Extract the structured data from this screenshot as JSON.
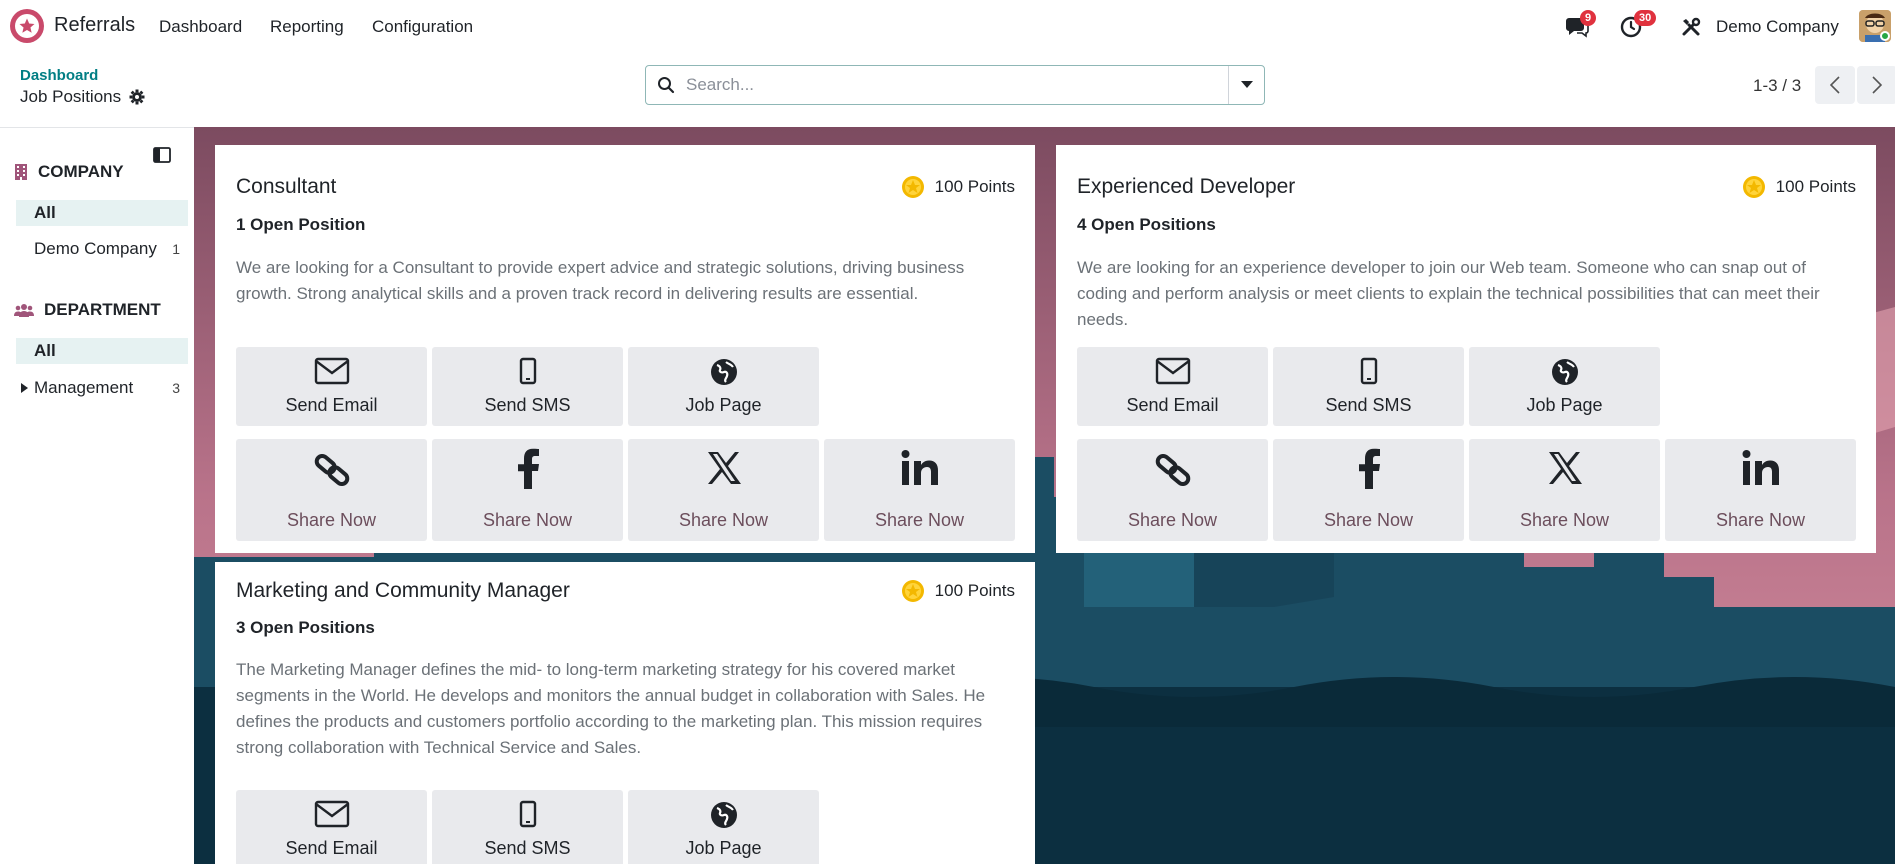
{
  "app": {
    "name": "Referrals"
  },
  "nav": {
    "items": [
      "Dashboard",
      "Reporting",
      "Configuration"
    ]
  },
  "systray": {
    "messages_count": "9",
    "activities_count": "30",
    "company": "Demo Company"
  },
  "control_panel": {
    "breadcrumb": "Dashboard",
    "title": "Job Positions",
    "search_placeholder": "Search...",
    "pager": "1-3 / 3"
  },
  "sidebar": {
    "company_heading": "COMPANY",
    "company_items": [
      {
        "label": "All",
        "count": ""
      },
      {
        "label": "Demo Company",
        "count": "1"
      }
    ],
    "department_heading": "DEPARTMENT",
    "department_items": [
      {
        "label": "All",
        "count": ""
      },
      {
        "label": "Management",
        "count": "3"
      }
    ]
  },
  "jobs": [
    {
      "title": "Consultant",
      "points": "100 Points",
      "open": "1 Open Position",
      "description": "We are looking for a Consultant to provide expert advice and strategic solutions, driving business growth. Strong analytical skills and a proven track record in delivering results are essential."
    },
    {
      "title": "Experienced Developer",
      "points": "100 Points",
      "open": "4 Open Positions",
      "description": "We are looking for an experience developer to join our Web team. Someone who can snap out of coding and perform analysis or meet clients to explain the technical possibilities that can meet their needs."
    },
    {
      "title": "Marketing and Community Manager",
      "points": "100 Points",
      "open": "3 Open Positions",
      "description": "The Marketing Manager defines the mid- to long-term marketing strategy for his covered market segments in the World. He develops and monitors the annual budget in collaboration with Sales. He defines the products and customers portfolio according to the marketing plan. This mission requires strong collaboration with Technical Service and Sales."
    }
  ],
  "actions": {
    "send_email": "Send Email",
    "send_sms": "Send SMS",
    "job_page": "Job Page",
    "share_now": "Share Now"
  },
  "colors": {
    "accent": "#017e84",
    "badge": "#e0323e",
    "star": "#f3b800",
    "share_text": "#6c4e5c"
  }
}
